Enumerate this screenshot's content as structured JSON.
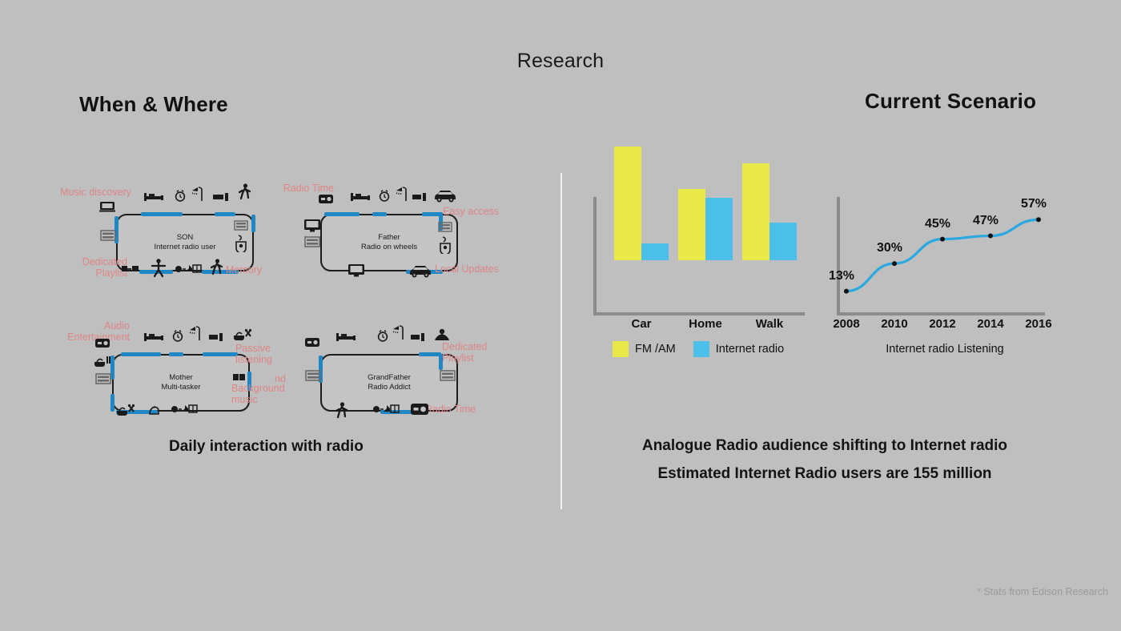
{
  "deck": {
    "title": "Research",
    "footnote": "* Stats from Edison Research"
  },
  "sections": {
    "left": {
      "title": "When & Where",
      "caption": "Daily interaction with radio"
    },
    "right": {
      "title": "Current Scenario",
      "stat_line_1": "Analogue Radio audience shifting to Internet radio",
      "stat_line_2": "Estimated Internet Radio users are 155 million"
    }
  },
  "personas": [
    {
      "id": "son",
      "name": "SON",
      "role": "Internet radio user",
      "labels": {
        "top_left": "Music discovery",
        "bottom_left": "Dedicated\nPlaylist",
        "bottom_right": "Memory"
      },
      "icons": {
        "top": [
          "bed-icon",
          "alarm-clock-icon",
          "shower-icon",
          "device-icon",
          "walking-person-icon"
        ],
        "left": [
          "laptop-icon",
          "train-seat-icon"
        ],
        "bottom": [
          "tv-remote-icon",
          "exercise-person-icon",
          "kitchen-icon",
          "walking-person-icon"
        ],
        "right": [
          "train-seat-icon",
          "desk-work-icon"
        ]
      }
    },
    {
      "id": "father",
      "name": "Father",
      "role": "Radio on wheels",
      "labels": {
        "top_left": "Radio Time",
        "top_right": "Easy access",
        "bottom_right": "Local Updates"
      },
      "icons": {
        "top": [
          "radio-icon",
          "bed-icon",
          "alarm-clock-icon",
          "shower-icon",
          "device-icon",
          "car-icon"
        ],
        "left": [
          "monitor-icon",
          "train-seat-icon"
        ],
        "bottom": [
          "monitor-icon",
          "car-icon"
        ],
        "right": [
          "train-seat-icon",
          "desk-work-icon"
        ]
      }
    },
    {
      "id": "mother",
      "name": "Mother",
      "role": "Multi-tasker",
      "labels": {
        "top_left": "Audio\nEntertainment",
        "right_upper": "Passive\nlistening",
        "right_lower": "Background\nmusic"
      },
      "icons": {
        "top": [
          "bed-icon",
          "alarm-clock-icon",
          "shower-icon",
          "device-icon",
          "cooking-icon"
        ],
        "left": [
          "radio-icon",
          "cooking-icon",
          "train-seat-icon"
        ],
        "bottom": [
          "cooking-icon",
          "iron-icon",
          "kitchen-icon"
        ],
        "right": [
          "speaker-icon"
        ]
      }
    },
    {
      "id": "grandfather",
      "name": "GrandFather",
      "role": "Radio Addict",
      "labels": {
        "top_right": "Dedicated\nPlaylist",
        "bottom_right": "Radio Time",
        "left_clip": "nd"
      },
      "icons": {
        "top": [
          "bed-icon",
          "alarm-clock-icon",
          "shower-icon",
          "device-icon",
          "meditation-icon"
        ],
        "left": [
          "radio-icon",
          "train-seat-icon"
        ],
        "bottom": [
          "walking-person-icon",
          "kitchen-icon",
          "radio-icon"
        ],
        "right": [
          "train-seat-icon"
        ]
      }
    }
  ],
  "chart_data": [
    {
      "type": "bar",
      "title": "",
      "categories": [
        "Car",
        "Home",
        "Walk"
      ],
      "series": [
        {
          "name": "FM /AM",
          "color": "#eae94a",
          "values": [
            96,
            60,
            82
          ]
        },
        {
          "name": "Internet radio",
          "color": "#4cbfe8",
          "values": [
            14,
            53,
            32
          ]
        }
      ],
      "xlabel": "",
      "ylabel": "",
      "ylim": [
        0,
        100
      ],
      "grid": false,
      "legend_position": "bottom-left"
    },
    {
      "type": "line",
      "title": "Internet radio Listening",
      "x": [
        "2008",
        "2010",
        "2012",
        "2014",
        "2016"
      ],
      "values": [
        13,
        30,
        45,
        47,
        57
      ],
      "point_labels": [
        "13%",
        "30%",
        "45%",
        "47%",
        "57%"
      ],
      "color": "#2aa8e0",
      "xlabel": "Internet radio Listening",
      "ylabel": "",
      "ylim": [
        0,
        65
      ],
      "grid": false,
      "legend_position": "none"
    }
  ]
}
